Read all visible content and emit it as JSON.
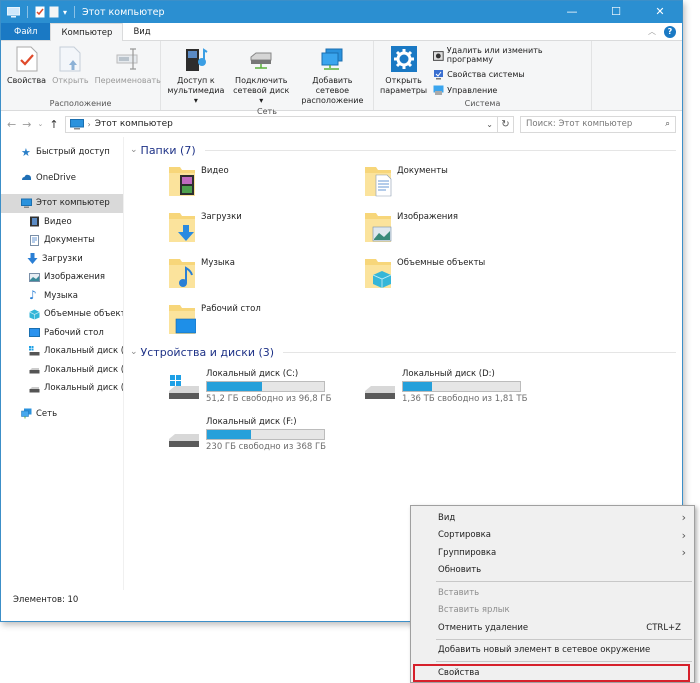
{
  "window": {
    "title": "Этот компьютер",
    "controls": {
      "minimize": "—",
      "maximize": "☐",
      "close": "✕"
    }
  },
  "ribbon_tabs": [
    {
      "label": "Файл"
    },
    {
      "label": "Компьютер"
    },
    {
      "label": "Вид"
    }
  ],
  "ribbon": {
    "groups": {
      "location": {
        "label": "Расположение",
        "buttons": [
          {
            "label": "Свойства",
            "icon": "properties-icon",
            "enabled": true
          },
          {
            "label": "Открыть",
            "icon": "open-icon",
            "enabled": false
          },
          {
            "label": "Переименовать",
            "icon": "rename-icon",
            "enabled": false
          }
        ]
      },
      "network": {
        "label": "Сеть",
        "buttons": [
          {
            "line1": "Доступ к",
            "line2": "мультимедиа ▾",
            "icon": "media-access-icon"
          },
          {
            "line1": "Подключить",
            "line2": "сетевой диск ▾",
            "icon": "map-network-drive-icon"
          },
          {
            "line1": "Добавить сетевое",
            "line2": "расположение",
            "icon": "add-network-location-icon"
          }
        ]
      },
      "system": {
        "label": "Система",
        "open_settings": {
          "line1": "Открыть",
          "line2": "параметры"
        },
        "items": [
          {
            "label": "Удалить или изменить программу"
          },
          {
            "label": "Свойства системы"
          },
          {
            "label": "Управление"
          }
        ]
      }
    }
  },
  "address": {
    "path": "Этот компьютер",
    "search_placeholder": "Поиск: Этот компьютер"
  },
  "sidebar": {
    "items": [
      {
        "label": "Быстрый доступ",
        "icon": "star-icon"
      },
      {
        "label": "OneDrive",
        "icon": "cloud-icon"
      },
      {
        "label": "Этот компьютер",
        "icon": "computer-icon",
        "selected": true
      },
      {
        "label": "Видео",
        "icon": "video-icon"
      },
      {
        "label": "Документы",
        "icon": "documents-icon"
      },
      {
        "label": "Загрузки",
        "icon": "downloads-icon"
      },
      {
        "label": "Изображения",
        "icon": "pictures-icon"
      },
      {
        "label": "Музыка",
        "icon": "music-icon"
      },
      {
        "label": "Объемные объекты",
        "icon": "3d-objects-icon"
      },
      {
        "label": "Рабочий стол",
        "icon": "desktop-icon"
      },
      {
        "label": "Локальный диск (C:)",
        "icon": "drive-icon"
      },
      {
        "label": "Локальный диск (D:)",
        "icon": "drive-icon"
      },
      {
        "label": "Локальный диск (F:)",
        "icon": "drive-icon"
      },
      {
        "label": "Сеть",
        "icon": "network-icon"
      }
    ]
  },
  "folders_section": {
    "title": "Папки (7)",
    "folders": [
      {
        "name": "Видео"
      },
      {
        "name": "Документы"
      },
      {
        "name": "Загрузки"
      },
      {
        "name": "Изображения"
      },
      {
        "name": "Музыка"
      },
      {
        "name": "Объемные объекты"
      },
      {
        "name": "Рабочий стол"
      }
    ]
  },
  "drives_section": {
    "title": "Устройства и диски (3)",
    "drives": [
      {
        "name": "Локальный диск (C:)",
        "free": "51,2 ГБ свободно из 96,8 ГБ",
        "used_fraction": 0.47
      },
      {
        "name": "Локальный диск (D:)",
        "free": "1,36 ТБ свободно из 1,81 ТБ",
        "used_fraction": 0.25
      },
      {
        "name": "Локальный диск (F:)",
        "free": "230 ГБ свободно из 368 ГБ",
        "used_fraction": 0.375
      }
    ],
    "bar_color": "#26a0da"
  },
  "status": {
    "items_count": "Элементов: 10"
  },
  "context_menu": {
    "items": [
      {
        "label": "Вид",
        "submenu": true
      },
      {
        "label": "Сортировка",
        "submenu": true
      },
      {
        "label": "Группировка",
        "submenu": true
      },
      {
        "label": "Обновить"
      },
      {
        "label": "Вставить",
        "disabled": true
      },
      {
        "label": "Вставить ярлык",
        "disabled": true
      },
      {
        "label": "Отменить удаление",
        "shortcut": "CTRL+Z"
      },
      {
        "label": "Добавить новый элемент в сетевое окружение"
      },
      {
        "label": "Свойства",
        "highlighted": true
      }
    ],
    "highlight_color": "#d6202b"
  }
}
